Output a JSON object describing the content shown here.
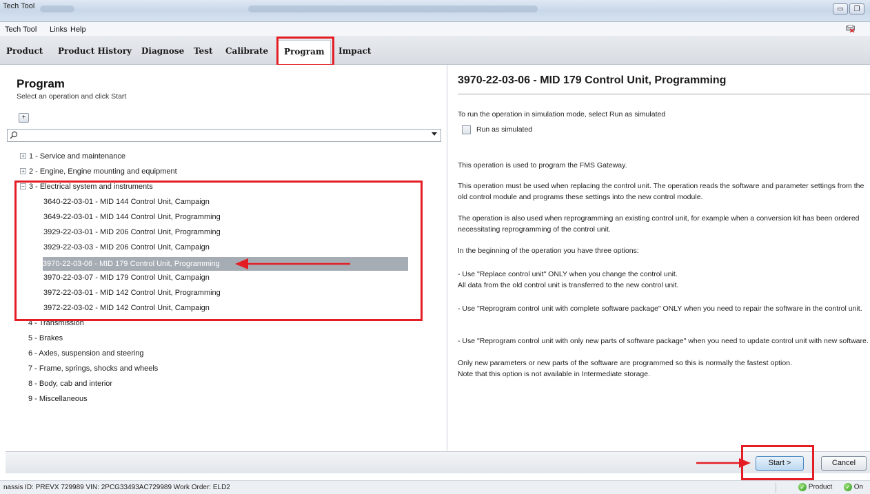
{
  "window": {
    "title": "Tech Tool"
  },
  "menu": [
    "Tech Tool",
    "Links",
    "Help"
  ],
  "tabs": [
    "Product",
    "Product History",
    "Diagnose",
    "Test",
    "Calibrate",
    "Program",
    "Impact"
  ],
  "active_tab": "Program",
  "left": {
    "heading": "Program",
    "subtitle": "Select an operation and click Start",
    "expand_glyph": "+",
    "search_value": "",
    "tree": [
      {
        "label": "1 - Service and maintenance",
        "expander": "+"
      },
      {
        "label": "2 - Engine, Engine mounting and equipment",
        "expander": "+"
      },
      {
        "label": "3 - Electrical system and instruments",
        "expander": "−"
      }
    ],
    "children": [
      "3640-22-03-01 - MID 144 Control Unit, Campaign",
      "3649-22-03-01 - MID 144 Control Unit, Programming",
      "3929-22-03-01 - MID 206 Control Unit, Programming",
      "3929-22-03-03 - MID 206 Control Unit, Campaign",
      "3970-22-03-06 - MID 179 Control Unit, Programming",
      "3970-22-03-07 - MID 179 Control Unit, Campaign",
      "3972-22-03-01 - MID 142 Control Unit, Programming",
      "3972-22-03-02 - MID 142 Control Unit, Campaign"
    ],
    "more": [
      "4 - Transmission",
      "5 - Brakes",
      "6 - Axles, suspension and steering",
      "7 - Frame, springs, shocks and wheels",
      "8 - Body, cab and interior",
      "9 - Miscellaneous"
    ]
  },
  "right": {
    "heading": "3970-22-03-06 - MID 179 Control Unit, Programming",
    "sim_instruction": "To run the operation in simulation mode, select Run as simulated",
    "sim_label": "Run as simulated",
    "p1": "This operation is used to program the FMS Gateway.",
    "p2": "This operation must be used when replacing the control unit. The operation reads the software and parameter settings from the old control module and programs these settings into the new control module.",
    "p3": "The operation is also used when reprogramming an existing control unit, for example when a conversion kit has been ordered necessitating reprogramming of the control unit.",
    "p4": "In the beginning of the operation you have three options:",
    "p5a": "- Use \"Replace control unit\" ONLY when you change the control unit.",
    "p5b": "All data from the old control unit is transferred to the new control unit.",
    "p6": "- Use \"Reprogram control unit with complete software package\" ONLY when you need to repair the software in the control unit.",
    "p7a": "- Use \"Reprogram control unit with only new parts of software package\" when you need to update control unit with new software.",
    "p7b": "Only new parameters or new parts of the software are programmed so this is normally the fastest option.",
    "p7c": "Note that this option is not available in Intermediate storage."
  },
  "buttons": {
    "start": "Start >",
    "cancel": "Cancel"
  },
  "status": {
    "left_text": "nassis ID: PREVX 729989   VIN: 2PCG33493AC729989   Work Order: ELD2",
    "product": "Product",
    "online": "On"
  },
  "colors": {
    "highlight": "#e41d24",
    "selected_row": "#a6acb4",
    "ok_green": "#2f9a1e"
  }
}
